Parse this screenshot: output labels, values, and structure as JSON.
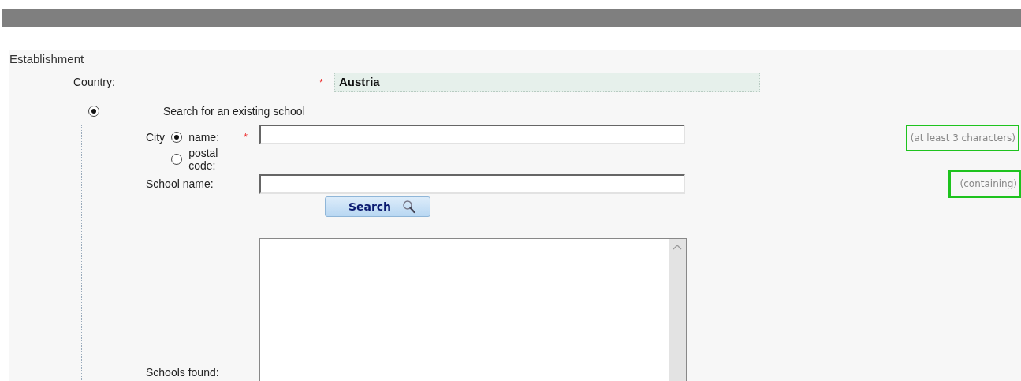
{
  "section": {
    "title": "Establishment"
  },
  "country": {
    "label": "Country:",
    "required_mark": "*",
    "value": "Austria"
  },
  "search_mode": {
    "label": "Search for an existing school",
    "selected": true
  },
  "city": {
    "label": "City",
    "required_mark": "*",
    "hint": "(at least 3 characters)",
    "options": [
      {
        "label": "name:",
        "selected": true
      },
      {
        "label": "postal code:",
        "selected": false
      }
    ]
  },
  "school_name": {
    "label": "School name:",
    "hint": "(containing)"
  },
  "search_button": {
    "label": "Search"
  },
  "schools_found": {
    "label": "Schools found:"
  }
}
